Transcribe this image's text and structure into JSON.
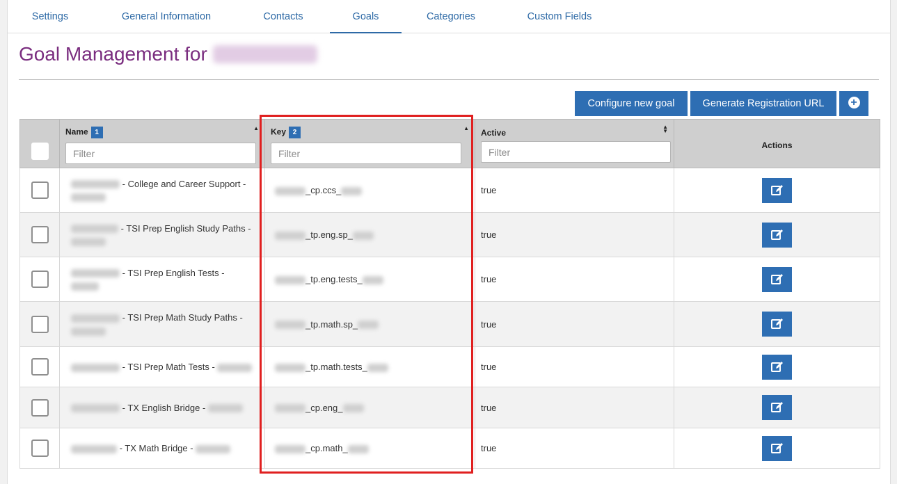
{
  "tabs": [
    {
      "label": "Settings"
    },
    {
      "label": "General Information"
    },
    {
      "label": "Contacts"
    },
    {
      "label": "Goals",
      "active": true
    },
    {
      "label": "Categories"
    },
    {
      "label": "Custom Fields"
    }
  ],
  "page": {
    "title": "Goal Management for"
  },
  "toolbar": {
    "configure_label": "Configure new goal",
    "registration_label": "Generate Registration URL",
    "add_icon": "plus-circle-icon"
  },
  "table": {
    "columns": {
      "name": {
        "label": "Name",
        "badge": "1"
      },
      "key": {
        "label": "Key",
        "badge": "2"
      },
      "active": {
        "label": "Active"
      },
      "actions": {
        "label": "Actions"
      }
    },
    "filter_placeholder": "Filter",
    "rows": [
      {
        "name": "- College and Career Support -",
        "key": "_cp.ccs_",
        "active": "true"
      },
      {
        "name": "- TSI Prep English Study Paths -",
        "key": "_tp.eng.sp_",
        "active": "true"
      },
      {
        "name": "- TSI Prep English Tests -",
        "key": "_tp.eng.tests_",
        "active": "true"
      },
      {
        "name": "- TSI Prep Math Study Paths -",
        "key": "_tp.math.sp_",
        "active": "true"
      },
      {
        "name": "- TSI Prep Math Tests -",
        "key": "_tp.math.tests_",
        "active": "true"
      },
      {
        "name": "- TX English Bridge -",
        "key": "_cp.eng_",
        "active": "true"
      },
      {
        "name": "- TX Math Bridge -",
        "key": "_cp.math_",
        "active": "true"
      }
    ]
  },
  "colors": {
    "accent": "#2e6eb3",
    "title": "#7a2d7f",
    "highlight": "#e02020"
  }
}
